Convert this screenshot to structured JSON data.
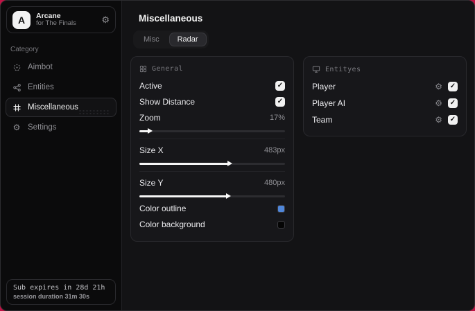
{
  "colors": {
    "accent_red": "#bf1244",
    "swatch_blue": "#4f86d9",
    "swatch_black": "#050505",
    "check_white": "#f1f1f1"
  },
  "sidebar": {
    "logo": {
      "letter": "A",
      "title": "Arcane",
      "subtitle": "for The Finals",
      "gear_glyph": "⚙"
    },
    "category_label": "Category",
    "items": [
      {
        "label": "Aimbot",
        "active": false
      },
      {
        "label": "Entities",
        "active": false
      },
      {
        "label": "Miscellaneous",
        "active": true
      },
      {
        "label": "Settings",
        "active": false
      }
    ],
    "footer": {
      "line1": "Sub expires in 28d 21h",
      "line2": "session duration 31m 30s"
    }
  },
  "main": {
    "title": "Miscellaneous",
    "tabs": [
      {
        "label": "Misc",
        "active": false
      },
      {
        "label": "Radar",
        "active": true
      }
    ],
    "general": {
      "title": "General",
      "toggles": [
        {
          "label": "Active",
          "checked": true,
          "check_glyph": "✓"
        },
        {
          "label": "Show Distance",
          "checked": true,
          "check_glyph": "✓"
        }
      ],
      "sliders": [
        {
          "label": "Zoom",
          "value": "17%",
          "fill_percent": 6
        },
        {
          "label": "Size X",
          "value": "483px",
          "fill_percent": 61
        },
        {
          "label": "Size Y",
          "value": "480px",
          "fill_percent": 60
        }
      ],
      "color_rows": [
        {
          "label": "Color outline"
        },
        {
          "label": "Color background"
        }
      ]
    },
    "entities": {
      "title": "Entityes",
      "rows": [
        {
          "label": "Player",
          "checked": true,
          "check_glyph": "✓",
          "gear_glyph": "⚙"
        },
        {
          "label": "Player AI",
          "checked": true,
          "check_glyph": "✓",
          "gear_glyph": "⚙"
        },
        {
          "label": "Team",
          "checked": true,
          "check_glyph": "✓",
          "gear_glyph": "⚙"
        }
      ]
    }
  }
}
